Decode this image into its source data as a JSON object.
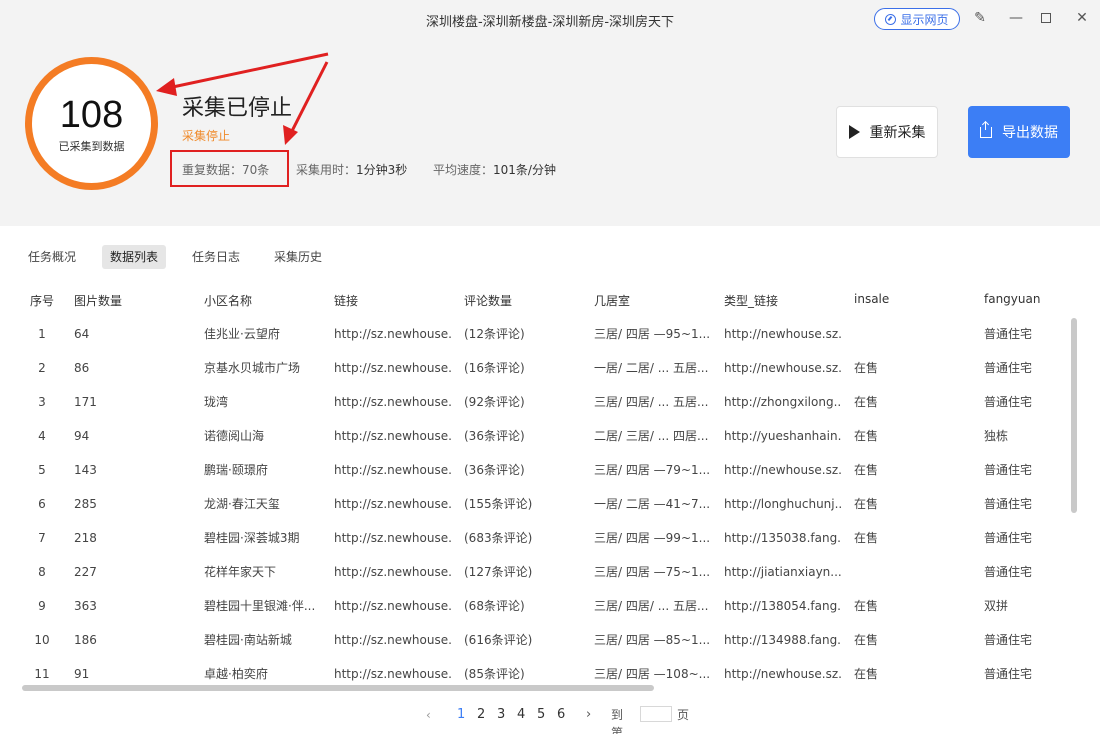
{
  "titlebar": {
    "title": "深圳楼盘-深圳新楼盘-深圳新房-深圳房天下",
    "show_web_label": "显示网页"
  },
  "summary": {
    "count": "108",
    "count_label": "已采集到数据",
    "status_title": "采集已停止",
    "status_sub": "采集停止",
    "duplicate": "重复数据：70条",
    "elapsed_label": "采集用时：",
    "elapsed_value": "1分钟3秒",
    "speed_label": "平均速度：",
    "speed_value": "101条/分钟"
  },
  "actions": {
    "restart_label": "重新采集",
    "export_label": "导出数据"
  },
  "tabs": [
    "任务概况",
    "数据列表",
    "任务日志",
    "采集历史"
  ],
  "table": {
    "headers": [
      "序号",
      "图片数量",
      "小区名称",
      "链接",
      "评论数量",
      "几居室",
      "类型_链接",
      "insale",
      "fangyuan"
    ],
    "rows": [
      [
        "1",
        "64",
        "佳兆业·云望府",
        "http://sz.newhouse....",
        "(12条评论)",
        "三居/ 四居 —95~1...",
        "http://newhouse.sz....",
        "",
        "普通住宅"
      ],
      [
        "2",
        "86",
        "京基水贝城市广场",
        "http://sz.newhouse....",
        "(16条评论)",
        "一居/ 二居/ ... 五居...",
        "http://newhouse.sz....",
        "在售",
        "普通住宅"
      ],
      [
        "3",
        "171",
        "珑湾",
        "http://sz.newhouse....",
        "(92条评论)",
        "三居/ 四居/ ... 五居...",
        "http://zhongxilong....",
        "在售",
        "普通住宅"
      ],
      [
        "4",
        "94",
        "诺德阅山海",
        "http://sz.newhouse....",
        "(36条评论)",
        "二居/ 三居/ ... 四居...",
        "http://yueshanhain....",
        "在售",
        "独栋"
      ],
      [
        "5",
        "143",
        "鹏瑞·颐璟府",
        "http://sz.newhouse....",
        "(36条评论)",
        "三居/ 四居 —79~1...",
        "http://newhouse.sz....",
        "在售",
        "普通住宅"
      ],
      [
        "6",
        "285",
        "龙湖·春江天玺",
        "http://sz.newhouse....",
        "(155条评论)",
        "一居/ 二居 —41~7...",
        "http://longhuchunj....",
        "在售",
        "普通住宅"
      ],
      [
        "7",
        "218",
        "碧桂园·深荟城3期",
        "http://sz.newhouse....",
        "(683条评论)",
        "三居/ 四居 —99~1...",
        "http://135038.fang....",
        "在售",
        "普通住宅"
      ],
      [
        "8",
        "227",
        "花样年家天下",
        "http://sz.newhouse....",
        "(127条评论)",
        "三居/ 四居 —75~1...",
        "http://jiatianxiayn....",
        "",
        "普通住宅"
      ],
      [
        "9",
        "363",
        "碧桂园十里银滩·伴...",
        "http://sz.newhouse....",
        "(68条评论)",
        "三居/ 四居/ ... 五居...",
        "http://138054.fang....",
        "在售",
        "双拼"
      ],
      [
        "10",
        "186",
        "碧桂园·南站新城",
        "http://sz.newhouse....",
        "(616条评论)",
        "三居/ 四居 —85~1...",
        "http://134988.fang....",
        "在售",
        "普通住宅"
      ],
      [
        "11",
        "91",
        "卓越·柏奕府",
        "http://sz.newhouse....",
        "(85条评论)",
        "三居/ 四居 —108~...",
        "http://newhouse.sz....",
        "在售",
        "普通住宅"
      ]
    ]
  },
  "pagination": {
    "prev": "‹",
    "pages": [
      "1",
      "2",
      "3",
      "4",
      "5",
      "6"
    ],
    "current": "1",
    "next": "›",
    "goto_label": "到第",
    "page_suffix": "页"
  },
  "colors": {
    "accent": "#3c7ef5",
    "ring": "#f47c24",
    "annotation": "#e02020"
  }
}
